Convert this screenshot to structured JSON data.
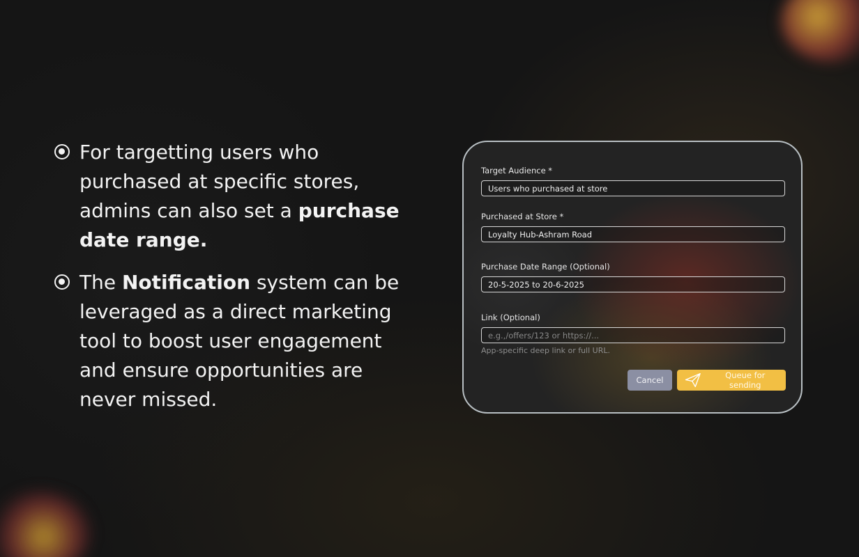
{
  "left_copy": {
    "bullet1": {
      "text_lead": "For targetting users who purchased at specific stores, admins can also set a ",
      "text_bold": "purchase date range."
    },
    "bullet2": {
      "text_lead": "The ",
      "text_bold": "Notification",
      "text_tail": " system can be leveraged as a direct marketing tool to boost user engagement and ensure opportunities are never missed."
    }
  },
  "form": {
    "target_audience": {
      "label": "Target Audience *",
      "value": "Users who purchased at store"
    },
    "purchased_at_store": {
      "label": "Purchased at Store *",
      "value": "Loyalty Hub-Ashram Road"
    },
    "purchase_date_range": {
      "label": "Purchase Date Range (Optional)",
      "value": "20-5-2025 to 20-6-2025"
    },
    "link": {
      "label": "Link (Optional)",
      "placeholder": "e.g.,/offers/123 or https://...",
      "helper": "App-specific deep link or full URL."
    },
    "cancel_label": "Cancel",
    "queue_label": "Queue for sending",
    "queue_icon": "send-icon"
  },
  "colors": {
    "background": "#151515",
    "card_border": "#b9c0c4",
    "cancel_button": "#8b8fa3",
    "queue_button": "#f2bf44",
    "text": "#f3f3f3"
  }
}
